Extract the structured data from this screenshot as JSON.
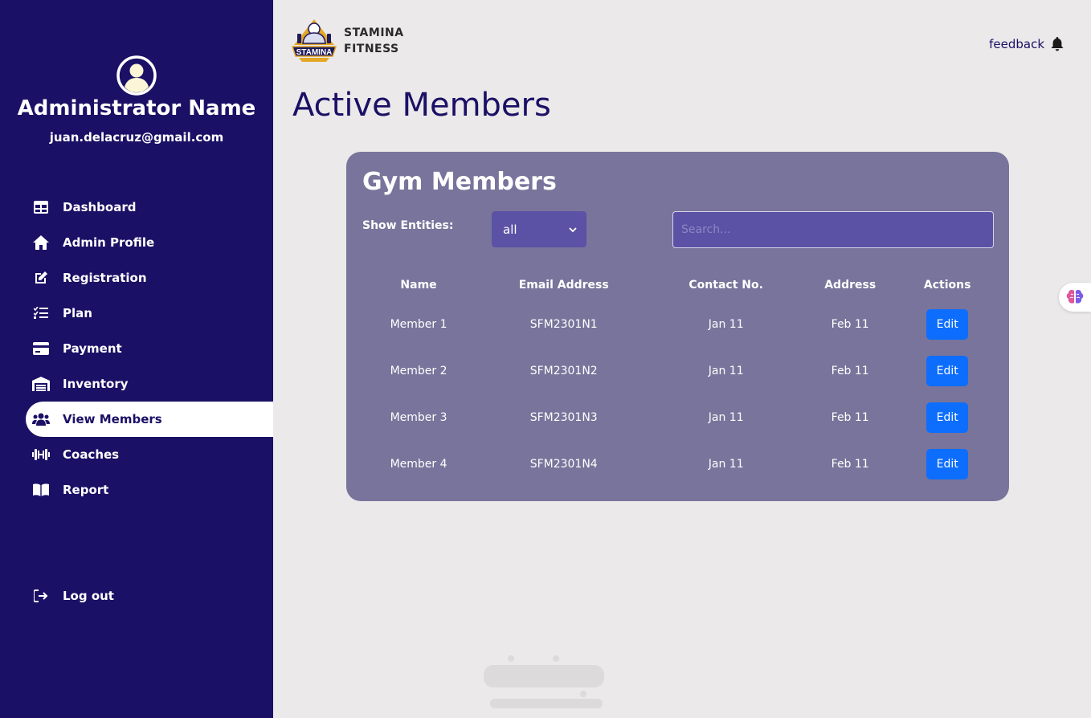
{
  "admin": {
    "name": "Administrator Name",
    "email": "juan.delacruz@gmail.com"
  },
  "sidebar": {
    "items": [
      {
        "label": "Dashboard",
        "icon": "table-icon"
      },
      {
        "label": "Admin Profile",
        "icon": "home-icon"
      },
      {
        "label": "Registration",
        "icon": "edit-icon"
      },
      {
        "label": "Plan",
        "icon": "list-check-icon"
      },
      {
        "label": "Payment",
        "icon": "credit-card-icon"
      },
      {
        "label": "Inventory",
        "icon": "warehouse-icon"
      },
      {
        "label": "View Members",
        "icon": "users-icon",
        "active": true
      },
      {
        "label": "Coaches",
        "icon": "dumbbell-icon"
      },
      {
        "label": "Report",
        "icon": "book-icon"
      }
    ],
    "logout_label": "Log out"
  },
  "brand": {
    "line1": "STAMINA",
    "line2": "FITNESS",
    "logo_text": "STAMINA"
  },
  "header": {
    "feedback_label": "feedback"
  },
  "page": {
    "title": "Active Members"
  },
  "card": {
    "title": "Gym Members",
    "show_label": "Show Entities:",
    "select_value": "all",
    "search_placeholder": "Search..."
  },
  "table": {
    "columns": [
      "Name",
      "Email Address",
      "Contact No.",
      "Address",
      "Actions"
    ],
    "rows": [
      {
        "name": "Member 1",
        "email": "SFM2301N1",
        "contact": "Jan 11",
        "address": "Feb 11",
        "action": "Edit"
      },
      {
        "name": "Member 2",
        "email": "SFM2301N2",
        "contact": "Jan 11",
        "address": "Feb 11",
        "action": "Edit"
      },
      {
        "name": "Member 3",
        "email": "SFM2301N3",
        "contact": "Jan 11",
        "address": "Feb 11",
        "action": "Edit"
      },
      {
        "name": "Member 4",
        "email": "SFM2301N4",
        "contact": "Jan 11",
        "address": "Feb 11",
        "action": "Edit"
      }
    ]
  },
  "colors": {
    "sidebar_bg": "#1a1065",
    "page_bg": "#ebe9ea",
    "card_bg": "#79749b",
    "input_bg": "#5b52a6",
    "button_blue": "#0d6efd"
  }
}
